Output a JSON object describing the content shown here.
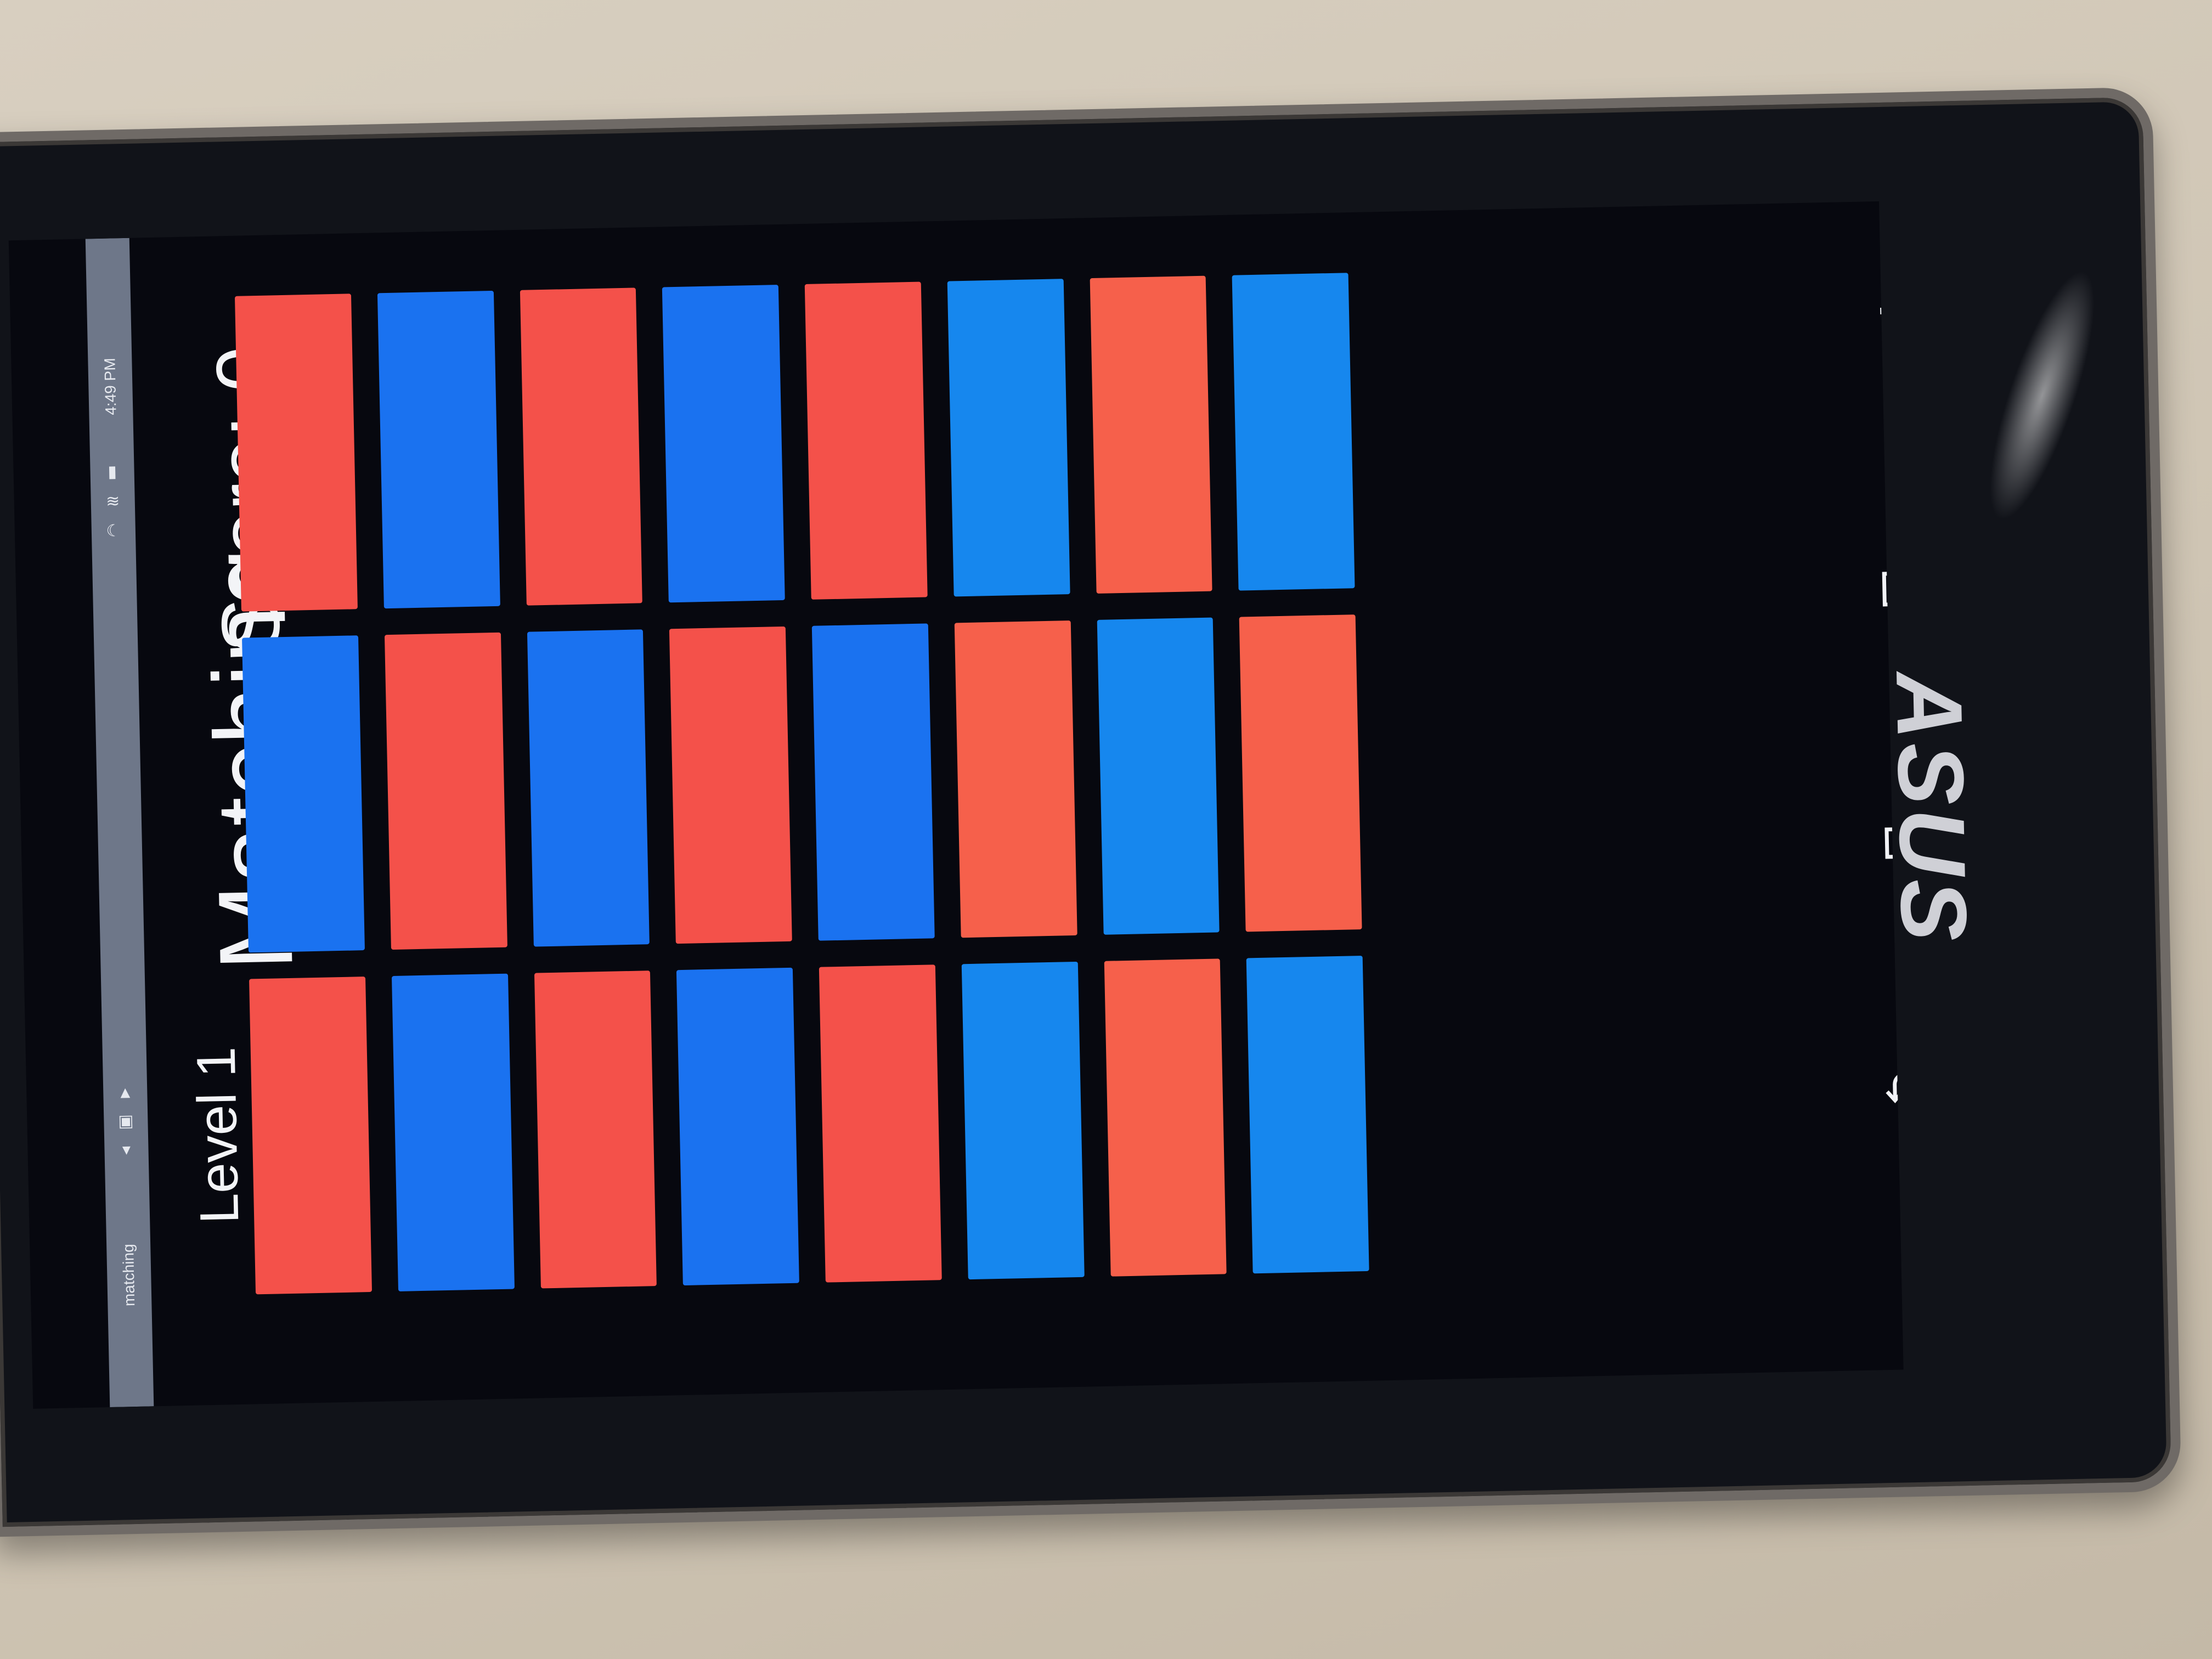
{
  "status_bar": {
    "app_name": "matching",
    "time": "4:49 PM",
    "icons": [
      "moon-icon",
      "wifi-icon",
      "battery-icon",
      "notification-icon",
      "image-icon",
      "warning-icon"
    ]
  },
  "header": {
    "level": "Level 1",
    "title": "Matching",
    "score_label": "Score:",
    "score_value": "0"
  },
  "grid": {
    "rows": 3,
    "columns": 8,
    "tiles": [
      [
        "red",
        "blue",
        "red",
        "blue",
        "red",
        "blue",
        "red",
        "blue"
      ],
      [
        "blue",
        "red",
        "blue",
        "red",
        "blue",
        "red",
        "blue",
        "red"
      ],
      [
        "red",
        "blue",
        "red",
        "blue",
        "red",
        "blue",
        "red",
        "blue"
      ]
    ]
  },
  "nav": {
    "icons": [
      "back-icon",
      "home-icon",
      "recent-apps-icon",
      "menu-icon"
    ]
  },
  "device": {
    "brand": "ASUS"
  },
  "colors": {
    "red": "#f4514a",
    "blue": "#1a72f0",
    "background": "#07080f"
  }
}
